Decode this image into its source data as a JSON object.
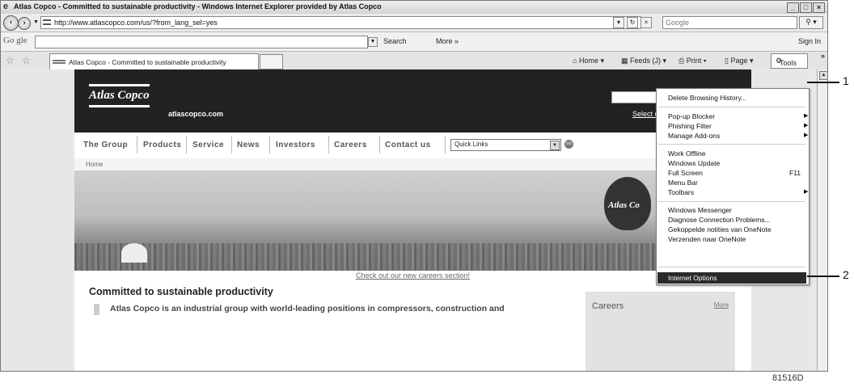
{
  "window": {
    "title": "Atlas Copco - Committed to sustainable productivity - Windows Internet Explorer provided by Atlas Copco"
  },
  "address": {
    "url": "http://www.atlascopco.com/us/?from_lang_sel=yes",
    "search_placeholder": "Google"
  },
  "google_toolbar": {
    "logo": "Go gle",
    "search_label": "Search",
    "more_label": "More »",
    "sign_in": "Sign In"
  },
  "tab": {
    "title": "Atlas Copco - Committed to sustainable productivity"
  },
  "command_bar": {
    "home": "Home",
    "feeds": "Feeds (J)",
    "print": "Print",
    "page": "Page",
    "tools": "Tools"
  },
  "site": {
    "logo": "Atlas Copco",
    "domain": "atlascopco.com",
    "select_country": "Select coun",
    "nav": [
      "The Group",
      "Products",
      "Service",
      "News",
      "Investors",
      "Careers",
      "Contact us"
    ],
    "quick_links": "Quick Links",
    "breadcrumb": "Home",
    "balloon_text": "Atlas Co",
    "careers_link": "Check out our new careers section!",
    "headline": "Committed to sustainable productivity",
    "body": "Atlas Copco is an industrial group with world-leading positions in compressors, construction and",
    "careers_box": {
      "title": "Careers",
      "more": "More"
    }
  },
  "tools_menu": {
    "items": [
      "Delete Browsing History...",
      "Pop-up Blocker",
      "Phishing Filter",
      "Manage Add-ons",
      "Work Offline",
      "Windows Update",
      "Full Screen",
      "Menu Bar",
      "Toolbars",
      "Windows Messenger",
      "Diagnose Connection Problems...",
      "Gekoppelde notities van OneNote",
      "Verzenden naar OneNote"
    ],
    "full_screen_shortcut": "F11",
    "selected": "Internet Options"
  },
  "callouts": {
    "one": "1",
    "two": "2"
  },
  "figure_code": "81516D"
}
